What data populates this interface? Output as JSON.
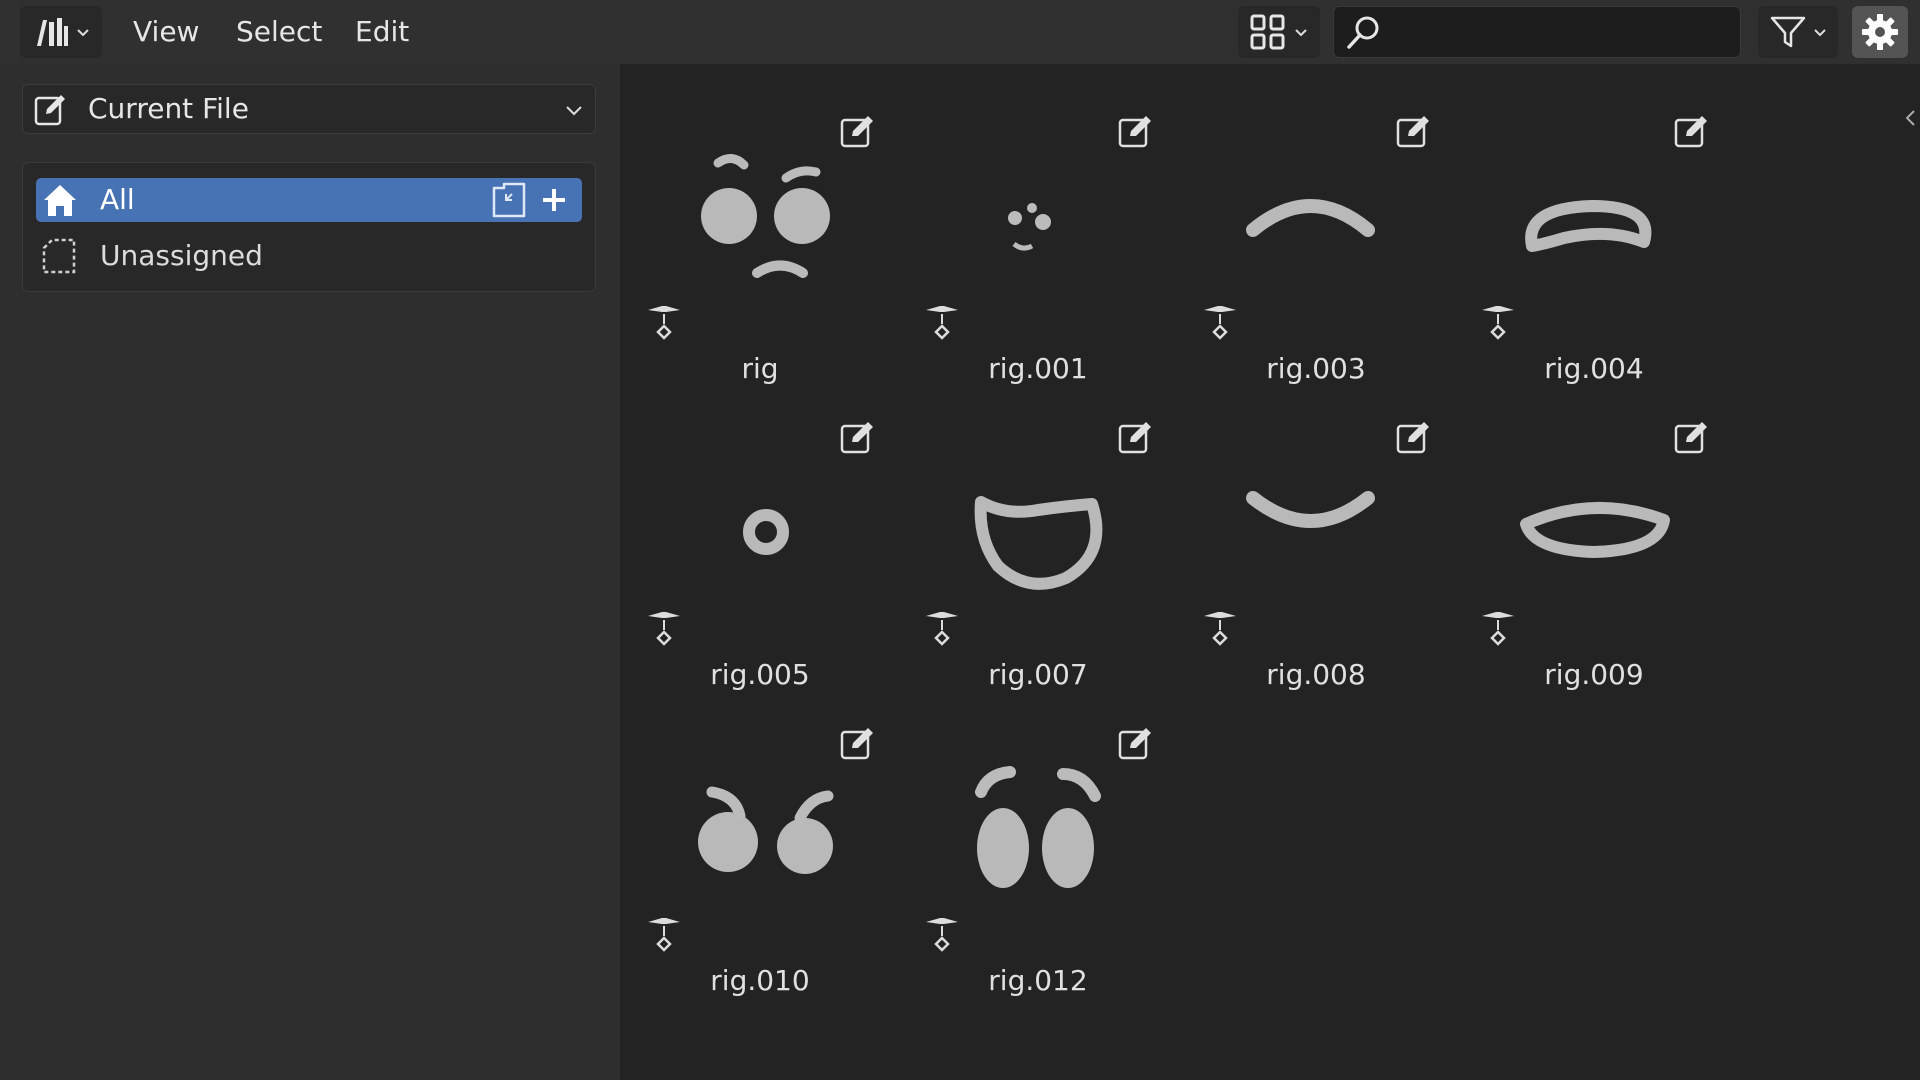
{
  "menu": {
    "items": [
      "View",
      "Select",
      "Edit"
    ]
  },
  "header": {
    "search": {
      "value": "",
      "placeholder": ""
    }
  },
  "sidebar": {
    "library_selector": "Current File",
    "catalogs": [
      {
        "label": "All",
        "selected": true
      },
      {
        "label": "Unassigned",
        "selected": false
      }
    ]
  },
  "assets": [
    {
      "name": "rig",
      "thumb": "eyes-brows-mouth"
    },
    {
      "name": "rig.001",
      "thumb": "small-face"
    },
    {
      "name": "rig.003",
      "thumb": "arch"
    },
    {
      "name": "rig.004",
      "thumb": "open-mouth"
    },
    {
      "name": "rig.005",
      "thumb": "ring"
    },
    {
      "name": "rig.007",
      "thumb": "u-mouth"
    },
    {
      "name": "rig.008",
      "thumb": "smile"
    },
    {
      "name": "rig.009",
      "thumb": "wide-mouth"
    },
    {
      "name": "rig.010",
      "thumb": "eyes-brows"
    },
    {
      "name": "rig.012",
      "thumb": "oval-eyes-brows"
    }
  ],
  "colors": {
    "selection": "#4772b3",
    "header": "#303030",
    "sidebar": "#2e2e2e",
    "grid": "#232323"
  }
}
